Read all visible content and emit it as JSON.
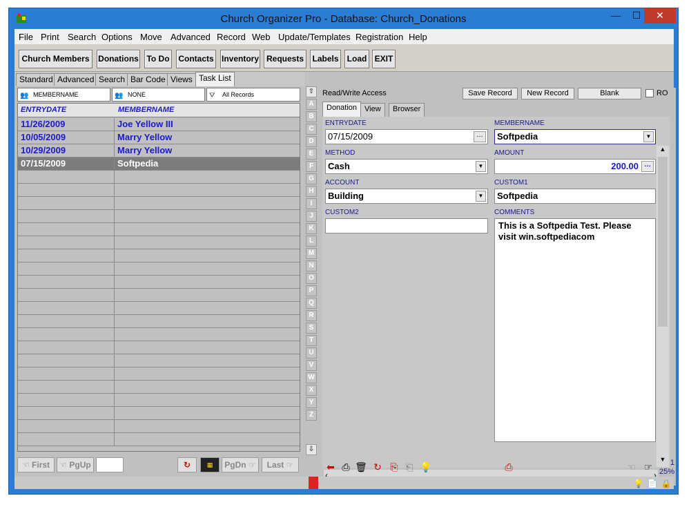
{
  "window": {
    "title": "Church Organizer Pro - Database: Church_Donations",
    "minimize": "—",
    "maximize": "☐",
    "close": "✕"
  },
  "menu": [
    "File",
    "Print",
    "Search",
    "Options",
    "Move",
    "Advanced",
    "Record",
    "Web",
    "Update/Templates",
    "Registration",
    "Help"
  ],
  "toolbar": {
    "buttons": [
      "Church Members",
      "Donations",
      "To Do",
      "Contacts",
      "Inventory",
      "Requests",
      "Labels",
      "Load",
      "EXIT"
    ]
  },
  "subtabs": [
    "Standard",
    "Advanced",
    "Search",
    "Bar Code",
    "Views",
    "Task List"
  ],
  "filters": {
    "field1": "MEMBERNAME",
    "field2": "NONE",
    "field3": "All Records"
  },
  "grid": {
    "columns": [
      "ENTRYDATE",
      "MEMBERNAME"
    ],
    "rows": [
      {
        "entrydate": "11/26/2009",
        "membername": "Joe Yellow III"
      },
      {
        "entrydate": "10/05/2009",
        "membername": "Marry Yellow"
      },
      {
        "entrydate": "10/29/2009",
        "membername": "Marry Yellow"
      },
      {
        "entrydate": "07/15/2009",
        "membername": "Softpedia"
      }
    ]
  },
  "nav": {
    "first": "First",
    "pgup": "PgUp",
    "pgdn": "PgDn",
    "last": "Last"
  },
  "letters": [
    "A",
    "B",
    "C",
    "D",
    "E",
    "F",
    "G",
    "H",
    "I",
    "J",
    "K",
    "L",
    "M",
    "N",
    "O",
    "P",
    "Q",
    "R",
    "S",
    "T",
    "U",
    "V",
    "W",
    "X",
    "Y",
    "Z"
  ],
  "record": {
    "access": "Read/Write Access",
    "save": "Save Record",
    "new": "New Record",
    "blank": "Blank",
    "ro": "RO",
    "tabs": [
      "Donation",
      "View",
      "Browser"
    ],
    "labels": {
      "entrydate": "ENTRYDATE",
      "membername": "MEMBERNAME",
      "method": "METHOD",
      "amount": "AMOUNT",
      "account": "ACCOUNT",
      "custom1": "CUSTOM1",
      "custom2": "CUSTOM2",
      "comments": "COMMENTS"
    },
    "values": {
      "entrydate": "07/15/2009",
      "membername": "Softpedia",
      "method": "Cash",
      "amount": "200.00",
      "account": "Building",
      "custom1": "Softpedia",
      "custom2": "",
      "comments": "This is a Softpedia Test. Please visit win.softpediacom"
    }
  },
  "status": {
    "record_no": "1",
    "zoom": "25%"
  }
}
